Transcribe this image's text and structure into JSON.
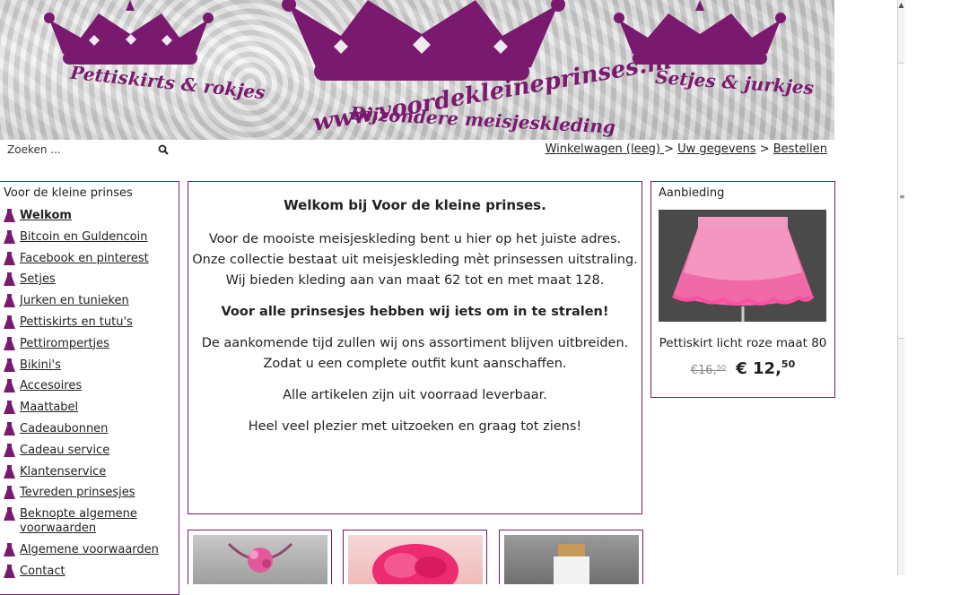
{
  "banner": {
    "left_text": "Pettiskirts & rokjes",
    "right_text": "Setjes & jurkjes",
    "url_text": "www.voordekleineprinses.nl",
    "sub_text": "Bijzondere meisjeskleding",
    "crown_color": "#7a1a6e"
  },
  "search": {
    "placeholder": "Zoeken ...",
    "icon": "search-icon"
  },
  "cart_nav": {
    "cart": "Winkelwagen (leeg) ",
    "sep1": " > ",
    "details": "Uw gegevens",
    "sep2": " > ",
    "order": "Bestellen"
  },
  "sidebar": {
    "title": "Voor de kleine prinses",
    "items": [
      {
        "label": "Welkom"
      },
      {
        "label": "Bitcoin en Guldencoin"
      },
      {
        "label": "Facebook en pinterest"
      },
      {
        "label": "Setjes"
      },
      {
        "label": "Jurken en tunieken"
      },
      {
        "label": "Pettiskirts en tutu's"
      },
      {
        "label": "Pettirompertjes"
      },
      {
        "label": "Bikini's"
      },
      {
        "label": "Accesoires"
      },
      {
        "label": "Maattabel"
      },
      {
        "label": "Cadeaubonnen"
      },
      {
        "label": "Cadeau service"
      },
      {
        "label": "Klantenservice"
      },
      {
        "label": "Tevreden prinsesjes"
      },
      {
        "label": "Beknopte algemene voorwaarden"
      },
      {
        "label": "Algemene voorwaarden"
      },
      {
        "label": "Contact"
      }
    ]
  },
  "welcome": {
    "title": "Welkom bij Voor de kleine prinses.",
    "p1": "Voor de mooiste meisjeskleding bent u hier op het juiste adres.",
    "p2": "Onze collectie bestaat uit meisjeskleding mèt prinsessen uitstraling.",
    "p3": "Wij bieden kleding aan van maat 62 tot en met maat 128.",
    "p4": "Voor alle prinsesjes hebben wij iets om in te stralen!",
    "p5": "De aankomende tijd zullen wij ons assortiment blijven uitbreiden.",
    "p6": "Zodat u een complete outfit kunt aanschaffen.",
    "p7": "Alle artikelen zijn uit voorraad leverbaar.",
    "p8": "Heel veel plezier met uitzoeken en graag tot ziens!"
  },
  "offer": {
    "title": "Aanbieding",
    "product": "Pettiskirt licht roze maat 80",
    "old_price": "€16,⁵⁰",
    "new_price": "€ 12,",
    "new_cents": "50"
  },
  "colors": {
    "accent": "#7a1a6e",
    "border": "#7a1a6e"
  }
}
